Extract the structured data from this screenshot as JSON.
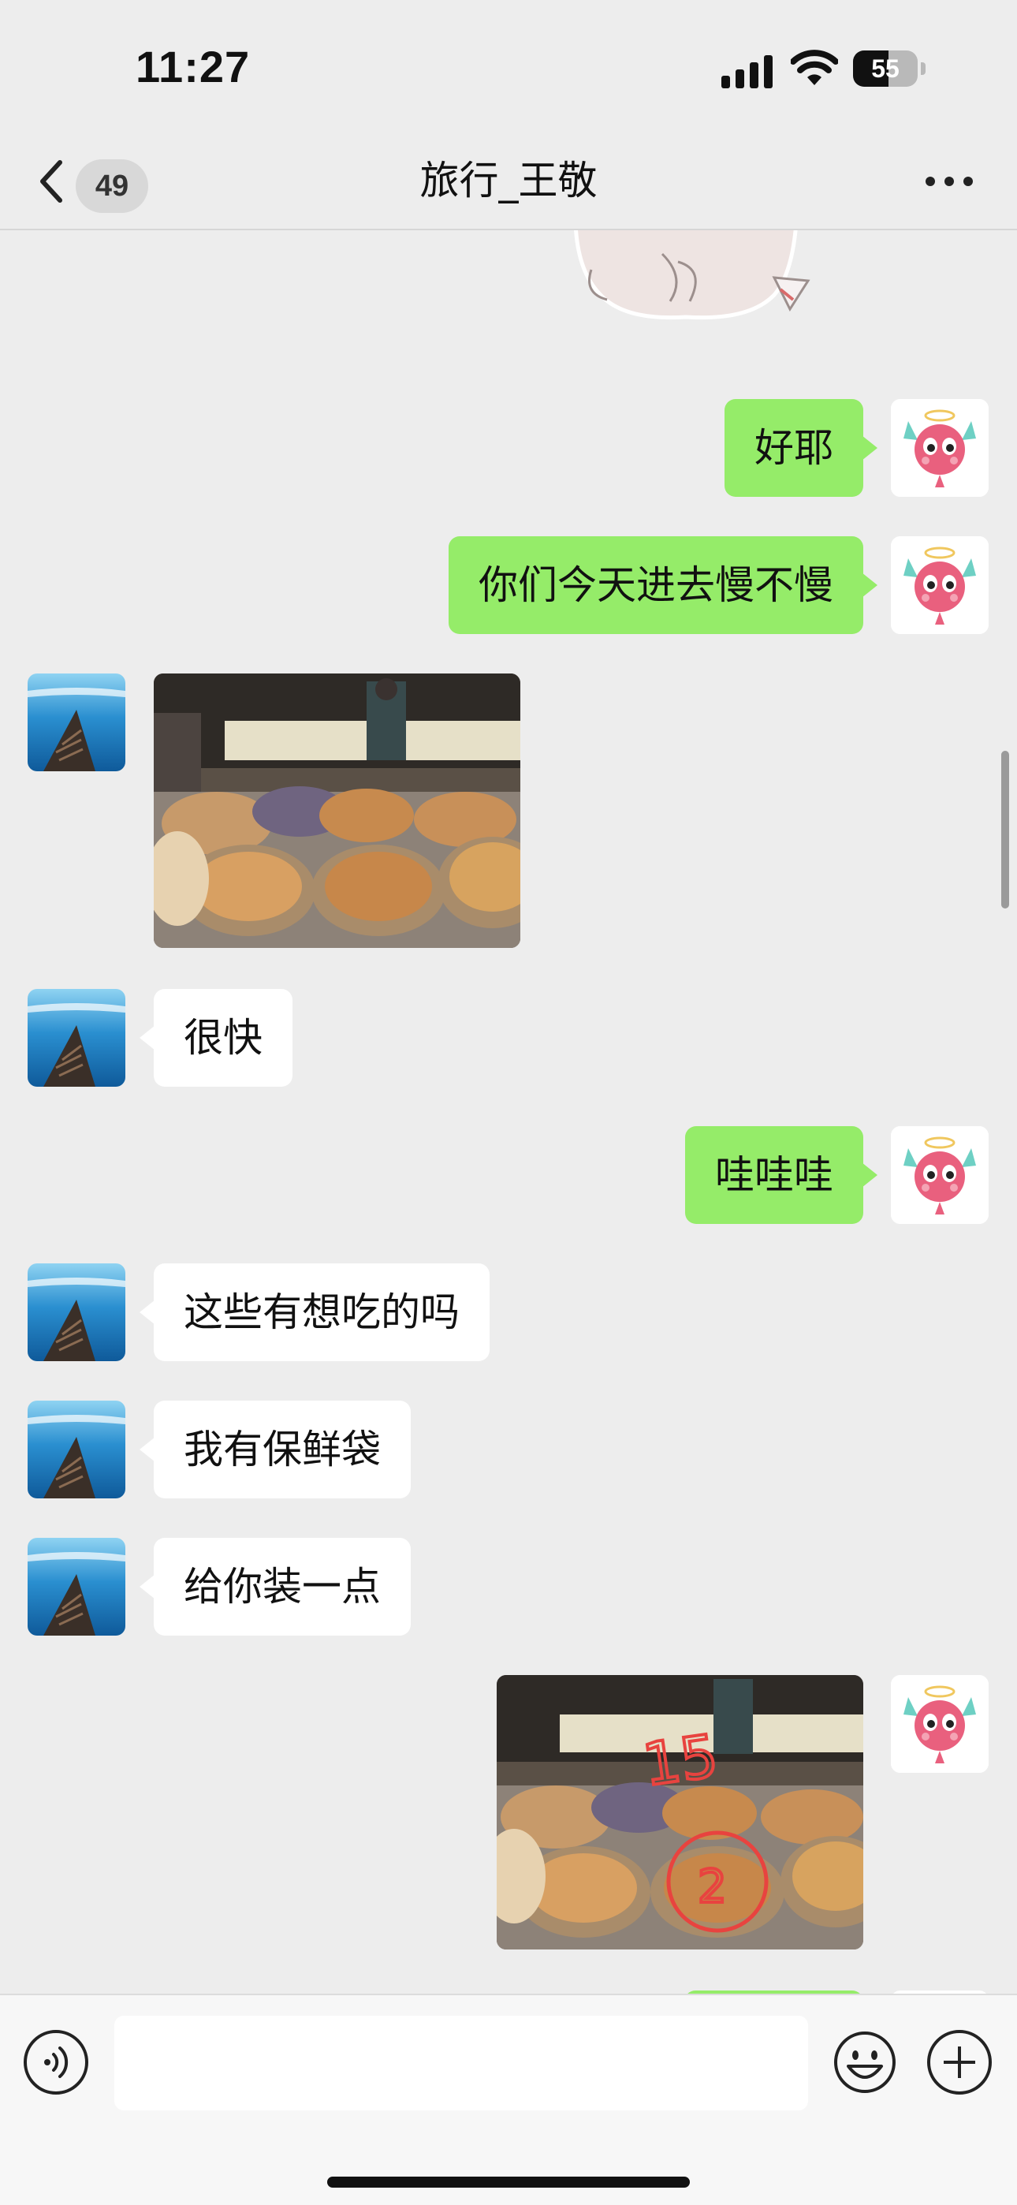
{
  "status_bar": {
    "time": "11:27",
    "battery_level": 55,
    "battery_text": "55",
    "icons": [
      "cellular-signal-icon",
      "wifi-icon",
      "battery-icon"
    ]
  },
  "nav": {
    "back_icon": "chevron-left-icon",
    "unread_count": "49",
    "title": "旅行_王敬",
    "more_icon": "more-dots-icon"
  },
  "messages": [
    {
      "sender": "self",
      "type": "text",
      "text": "好耶"
    },
    {
      "sender": "self",
      "type": "text",
      "text": "你们今天进去慢不慢"
    },
    {
      "sender": "other",
      "type": "image",
      "description_icon": "bakery-photo"
    },
    {
      "sender": "other",
      "type": "text",
      "text": "很快"
    },
    {
      "sender": "self",
      "type": "text",
      "text": "哇哇哇"
    },
    {
      "sender": "other",
      "type": "text",
      "text": "这些有想吃的吗"
    },
    {
      "sender": "other",
      "type": "text",
      "text": "我有保鲜袋"
    },
    {
      "sender": "other",
      "type": "text",
      "text": "给你装一点"
    },
    {
      "sender": "self",
      "type": "image",
      "description_icon": "annotated-bakery-photo",
      "annotations": [
        "15",
        "2"
      ]
    }
  ],
  "input_bar": {
    "voice_icon": "voice-icon",
    "input_value": "",
    "emoji_icon": "emoji-icon",
    "plus_icon": "plus-icon"
  },
  "colors": {
    "background": "#ededed",
    "self_bubble": "#95ec69",
    "other_bubble": "#ffffff",
    "annotation_red": "#e8433f"
  }
}
